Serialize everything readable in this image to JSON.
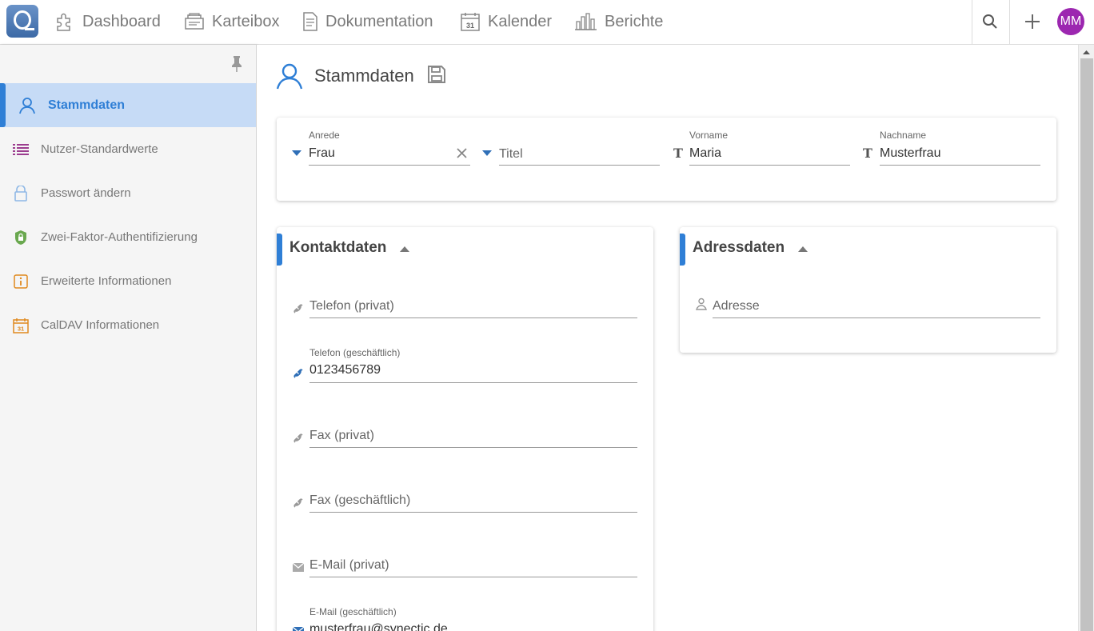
{
  "topbar": {
    "nav": [
      {
        "label": "Dashboard",
        "icon": "puzzle-icon"
      },
      {
        "label": "Karteibox",
        "icon": "card-box-icon"
      },
      {
        "label": "Dokumentation",
        "icon": "document-icon"
      },
      {
        "label": "Kalender",
        "icon": "calendar-icon"
      },
      {
        "label": "Berichte",
        "icon": "bar-chart-icon"
      }
    ],
    "calendar_day": "31",
    "avatar_initials": "MM"
  },
  "sidebar": {
    "items": [
      {
        "label": "Stammdaten",
        "icon": "user-icon",
        "active": true
      },
      {
        "label": "Nutzer-Standardwerte",
        "icon": "list-icon"
      },
      {
        "label": "Passwort ändern",
        "icon": "lock-icon"
      },
      {
        "label": "Zwei-Faktor-Authentifizierung",
        "icon": "shield-lock-icon"
      },
      {
        "label": "Erweiterte Informationen",
        "icon": "info-icon"
      },
      {
        "label": "CalDAV Informationen",
        "icon": "calendar-icon"
      }
    ],
    "calendar_day": "31"
  },
  "main": {
    "title": "Stammdaten",
    "name_card": {
      "anrede": {
        "label": "Anrede",
        "value": "Frau"
      },
      "titel": {
        "placeholder": "Titel"
      },
      "vorname": {
        "label": "Vorname",
        "value": "Maria"
      },
      "nachname": {
        "label": "Nachname",
        "value": "Musterfrau"
      }
    },
    "kontakt": {
      "title": "Kontaktdaten",
      "fields": [
        {
          "placeholder": "Telefon (privat)",
          "label": "",
          "value": "",
          "icon": "phone-icon"
        },
        {
          "label": "Telefon (geschäftlich)",
          "value": "0123456789",
          "icon": "phone-icon"
        },
        {
          "placeholder": "Fax (privat)",
          "label": "",
          "value": "",
          "icon": "phone-icon"
        },
        {
          "placeholder": "Fax (geschäftlich)",
          "label": "",
          "value": "",
          "icon": "phone-icon"
        },
        {
          "placeholder": "E-Mail (privat)",
          "label": "",
          "value": "",
          "icon": "mail-icon"
        },
        {
          "label": "E-Mail (geschäftlich)",
          "value": "musterfrau@synectic.de",
          "icon": "mail-icon"
        }
      ]
    },
    "adress": {
      "title": "Adressdaten",
      "field": {
        "placeholder": "Adresse",
        "icon": "location-person-icon"
      }
    }
  },
  "colors": {
    "accent": "#2f7fd6",
    "active_bg": "#c6dbf6",
    "avatar": "#9c27b0",
    "sidebar_bg": "#f5f5f5"
  }
}
